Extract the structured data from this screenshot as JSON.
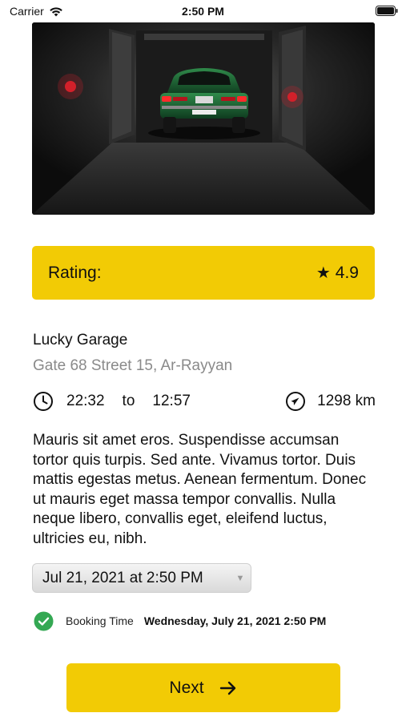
{
  "status_bar": {
    "carrier": "Carrier",
    "time": "2:50 PM"
  },
  "hero": {
    "plate_text": "A 7790 CA"
  },
  "rating": {
    "label": "Rating:",
    "star": "★",
    "value": "4.9"
  },
  "garage": {
    "name": "Lucky Garage",
    "address": "Gate 68 Street 15, Ar-Rayyan",
    "open_time": "22:32",
    "to_label": "to",
    "close_time": "12:57",
    "distance": "1298 km",
    "description": "Mauris sit amet eros. Suspendisse accumsan tortor quis turpis. Sed ante. Vivamus tortor. Duis mattis egestas metus. Aenean fermentum. Donec ut mauris eget massa tempor convallis. Nulla neque libero, convallis eget, eleifend luctus, ultricies eu, nibh."
  },
  "date_picker": {
    "value": "Jul 21, 2021 at 2:50 PM"
  },
  "booking": {
    "label": "Booking Time",
    "value": "Wednesday, July 21, 2021 2:50 PM"
  },
  "next_button": {
    "label": "Next"
  },
  "colors": {
    "accent": "#F2CB05",
    "success": "#34A853"
  }
}
